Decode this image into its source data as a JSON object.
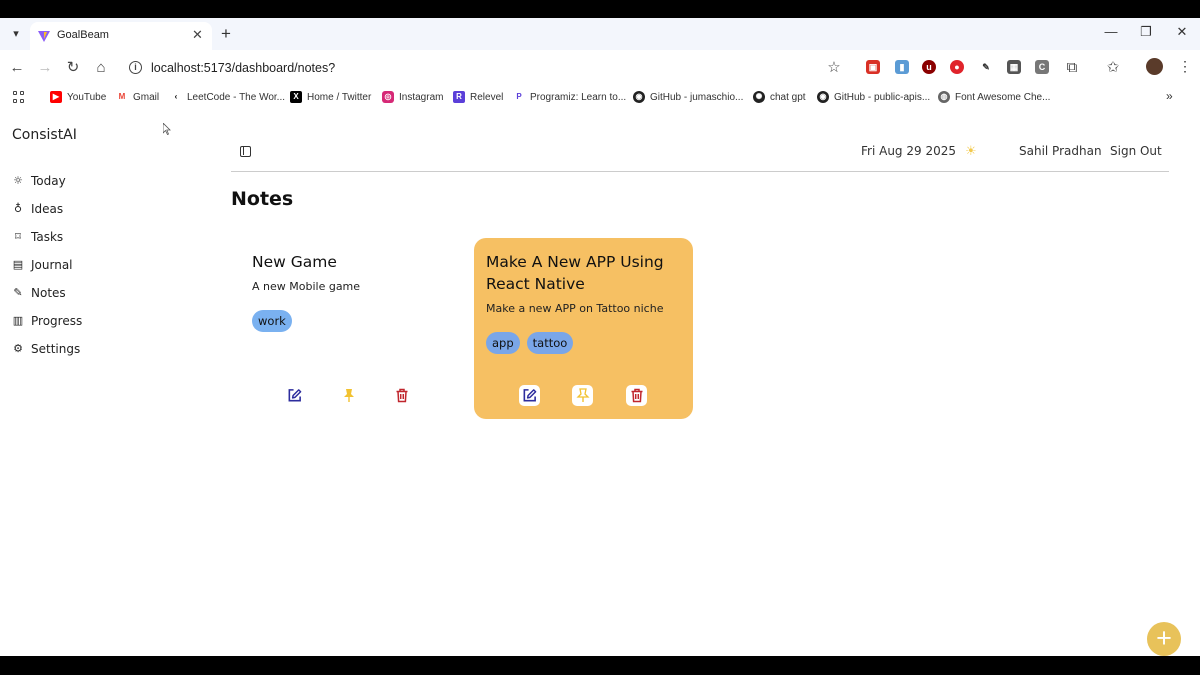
{
  "browser": {
    "tab_title": "GoalBeam",
    "url": "localhost:5173/dashboard/notes?",
    "bookmarks": [
      {
        "label": "YouTube",
        "icon": "youtube-icon"
      },
      {
        "label": "Gmail",
        "icon": "gmail-icon"
      },
      {
        "label": "LeetCode - The Wor...",
        "icon": "leetcode-icon"
      },
      {
        "label": "Home / Twitter",
        "icon": "x-icon"
      },
      {
        "label": "Instagram",
        "icon": "instagram-icon"
      },
      {
        "label": "Relevel",
        "icon": "relevel-icon"
      },
      {
        "label": "Programiz: Learn to...",
        "icon": "programiz-icon"
      },
      {
        "label": "GitHub - jumaschio...",
        "icon": "github-icon"
      },
      {
        "label": "chat gpt",
        "icon": "chatgpt-icon"
      },
      {
        "label": "GitHub - public-apis...",
        "icon": "github-icon"
      },
      {
        "label": "Font Awesome Che...",
        "icon": "globe-icon"
      }
    ]
  },
  "app": {
    "brand": "ConsistAI",
    "nav": [
      {
        "label": "Today",
        "icon": "sun-icon"
      },
      {
        "label": "Ideas",
        "icon": "lightbulb-icon"
      },
      {
        "label": "Tasks",
        "icon": "bookmark-icon"
      },
      {
        "label": "Journal",
        "icon": "notebook-icon"
      },
      {
        "label": "Notes",
        "icon": "edit-note-icon"
      },
      {
        "label": "Progress",
        "icon": "bar-chart-icon"
      },
      {
        "label": "Settings",
        "icon": "gear-icon"
      }
    ],
    "header": {
      "date": "Fri Aug 29 2025",
      "user": "Sahil Pradhan",
      "sign_out": "Sign Out"
    },
    "page_title": "Notes",
    "notes": [
      {
        "title": "New Game",
        "description": "A new Mobile game",
        "tags": [
          "work"
        ],
        "pinned": false
      },
      {
        "title": "Make A New APP Using React Native",
        "description": "Make a new APP on Tattoo niche",
        "tags": [
          "app",
          "tattoo"
        ],
        "pinned": true
      }
    ],
    "fab_label": "+"
  },
  "colors": {
    "pinned_card": "#f6c063",
    "tag": "#7ab1f0",
    "edit": "#2d2d9e",
    "pin": "#f2c230",
    "delete": "#c0262d",
    "fab": "#e8c25a"
  }
}
